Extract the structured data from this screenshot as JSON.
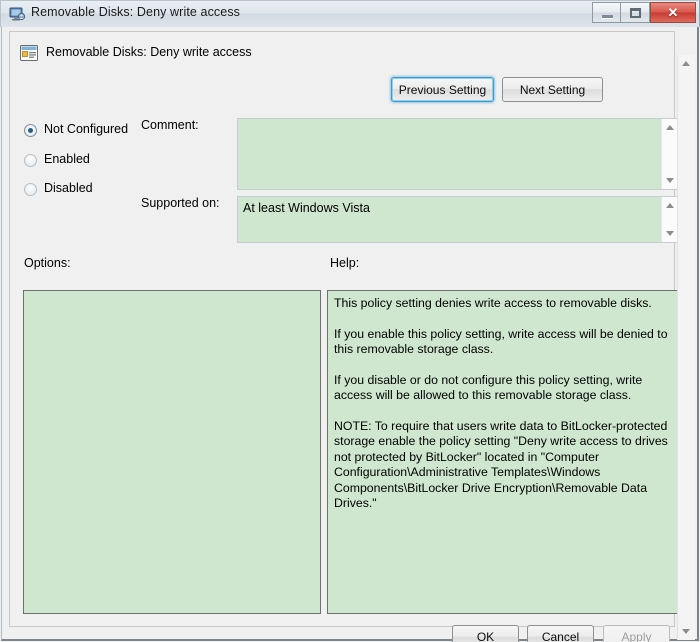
{
  "window": {
    "title": "Removable Disks: Deny write access",
    "title_icon": "computer-monitor-icon",
    "minimize_label": "",
    "maximize_label": "",
    "close_label": "✕"
  },
  "header": {
    "title": "Removable Disks: Deny write access",
    "icon": "policy-setting-icon",
    "previous_setting_label": "Previous Setting",
    "next_setting_label": "Next Setting"
  },
  "state_options": [
    {
      "label": "Not Configured",
      "checked": true
    },
    {
      "label": "Enabled",
      "checked": false
    },
    {
      "label": "Disabled",
      "checked": false
    }
  ],
  "comment": {
    "label": "Comment:",
    "value": "",
    "placeholder": ""
  },
  "supported_on": {
    "label": "Supported on:",
    "value": "At least Windows Vista"
  },
  "options": {
    "label": "Options:",
    "value": ""
  },
  "help": {
    "label": "Help:",
    "paragraphs": [
      "This policy setting denies write access to removable disks.",
      "If you enable this policy setting, write access will be denied to this removable storage class.",
      "If you disable or do not configure this policy setting, write access will be allowed to this removable storage class.",
      "NOTE: To require that users write data to BitLocker-protected storage enable the policy setting \"Deny write access to drives not protected by BitLocker\" located in \"Computer Configuration\\Administrative Templates\\Windows Components\\BitLocker Drive Encryption\\Removable Data Drives.\""
    ]
  },
  "footer": {
    "ok_label": "OK",
    "cancel_label": "Cancel",
    "apply_label": "Apply",
    "apply_disabled": true
  },
  "colors": {
    "field_background": "#cfe7cf",
    "dialog_background": "#f0f0f0",
    "focus_accent": "#3c9ad1",
    "close_button": "#c63c31"
  }
}
